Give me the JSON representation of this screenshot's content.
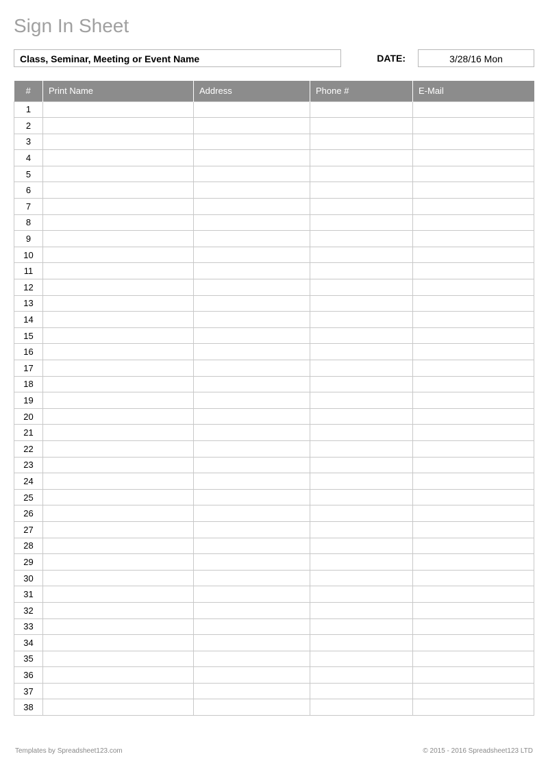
{
  "title": "Sign In Sheet",
  "header": {
    "event_placeholder": "Class, Seminar, Meeting or Event Name",
    "date_label": "DATE:",
    "date_value": "3/28/16 Mon"
  },
  "table": {
    "columns": {
      "num": "#",
      "name": "Print Name",
      "address": "Address",
      "phone": "Phone #",
      "email": "E-Mail"
    },
    "row_count": 38
  },
  "footer": {
    "left": "Templates by Spreadsheet123.com",
    "right": "© 2015 - 2016 Spreadsheet123 LTD"
  }
}
